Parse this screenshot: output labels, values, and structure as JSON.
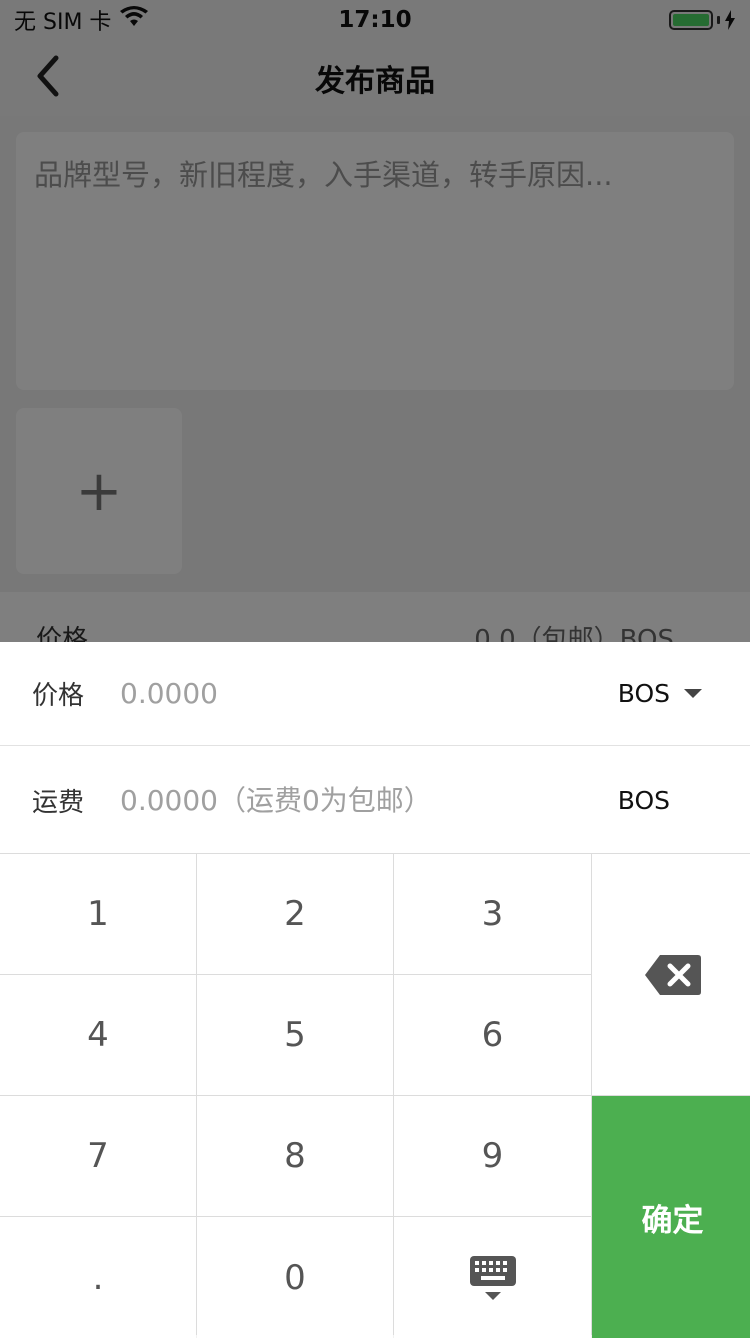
{
  "status_bar": {
    "carrier": "无 SIM 卡",
    "time": "17:10"
  },
  "nav": {
    "title": "发布商品"
  },
  "form": {
    "description_placeholder": "品牌型号，新旧程度，入手渠道，转手原因...",
    "add_photo": "+",
    "price_label": "价格",
    "price_value_summary": "0.0（包邮）BOS"
  },
  "sheet": {
    "price": {
      "label": "价格",
      "placeholder": "0.0000",
      "currency": "BOS"
    },
    "freight": {
      "label": "运费",
      "placeholder": "0.0000（运费0为包邮）",
      "currency": "BOS"
    }
  },
  "keypad": {
    "keys": [
      "1",
      "2",
      "3",
      "4",
      "5",
      "6",
      "7",
      "8",
      "9",
      ".",
      "0"
    ],
    "confirm_label": "确定"
  },
  "colors": {
    "accent": "#4caf50",
    "battery": "#4cd964"
  }
}
